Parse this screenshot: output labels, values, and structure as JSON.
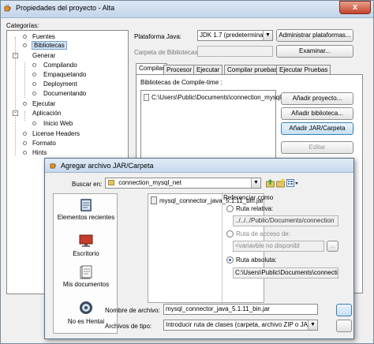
{
  "window": {
    "title": "Propiedades del proyecto - Alta",
    "close_label": "x"
  },
  "categories": {
    "label": "Categorías:",
    "items": [
      {
        "label": "Fuentes"
      },
      {
        "label": "Bibliotecas"
      },
      {
        "label": "Generar"
      },
      {
        "label": "Compilando"
      },
      {
        "label": "Empaquetando"
      },
      {
        "label": "Deployment"
      },
      {
        "label": "Documentando"
      },
      {
        "label": "Ejecutar"
      },
      {
        "label": "Aplicación"
      },
      {
        "label": "Inicio Web"
      },
      {
        "label": "License Headers"
      },
      {
        "label": "Formato"
      },
      {
        "label": "Hints"
      }
    ],
    "selected_index": 1
  },
  "platform": {
    "label": "Plataforma Java:",
    "value": "JDK 1.7 (predeterminad",
    "manage_button": "Administrar plataformas..."
  },
  "library_folder": {
    "label": "Carpeta de Bibliotecas:",
    "value": "",
    "browse_button": "Examinar..."
  },
  "tabs": [
    "Compilar",
    "Procesor",
    "Ejecutar",
    "Compilar pruebas",
    "Ejecutar Pruebas"
  ],
  "compile_tab": {
    "heading": "Bibliotecas de Compile-time :",
    "entries": [
      "C:\\Users\\Public\\Documents\\connection_mysql_"
    ],
    "add_project": "Añadir proyecto...",
    "add_library": "Añadir biblioteca...",
    "add_jar": "Añadir JAR/Carpeta",
    "edit": "Editar"
  },
  "dialog": {
    "title": "Agregar archivo JAR/Carpeta",
    "lookin_label": "Buscar en:",
    "lookin_value": "connection_mysql_net",
    "places": [
      "Elementos recientes",
      "Escritorio",
      "Mis documentos",
      "No es Hentai"
    ],
    "files": [
      "mysql_connector_java_5.1.11_bin.jar"
    ],
    "reference": {
      "label": "Referenciar como",
      "relative_label": "Ruta relativa:",
      "relative_value": "../../../Public/Documents/connection",
      "variable_label": "Ruta de acceso de:",
      "variable_value": "<variavble no disponibl",
      "variable_button": "...",
      "absolute_label": "Ruta absoluta:",
      "absolute_value": "C:\\Users\\Public\\Documents\\connection"
    },
    "filename_label": "Nombre de archivo:",
    "filename_value": "mysql_connector_java_5.1.11_bin.jar",
    "filetype_label": "Archivos de tipo:",
    "filetype_value": "Introducir ruta de clases (carpeta, archivo ZIP o JAR )"
  },
  "colors": {
    "accent": "#3c7fb1",
    "selection": "#cfe3f7"
  }
}
